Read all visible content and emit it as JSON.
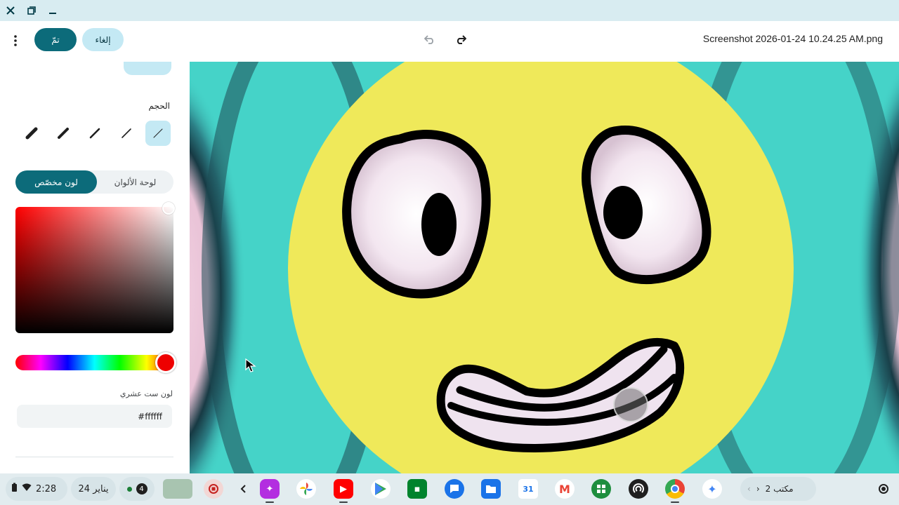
{
  "window": {
    "file_title": "Screenshot 2026-01-24 10.24.25 AM.png"
  },
  "header": {
    "done_label": "تمّ",
    "cancel_label": "إلغاء"
  },
  "panel": {
    "size_label": "الحجم",
    "size_options_count": 5,
    "color_mode": {
      "custom_label": "لون مخصّص",
      "palette_label": "لوحة الألوان",
      "selected": "custom"
    },
    "selected_hue_color": "#ee0000",
    "hex_label": "لون ست عشري",
    "hex_value": "#ffffff"
  },
  "shelf": {
    "time": "2:28",
    "date": "24 يناير",
    "notification_count": "4",
    "desk_label": "مكتب 2",
    "apps": [
      "screen-capture-icon",
      "photos-icon",
      "youtube-icon",
      "play-store-icon",
      "meet-icon",
      "chat-icon",
      "files-icon",
      "calendar-icon",
      "gmail-icon",
      "sheets-icon",
      "podcasts-icon",
      "chrome-icon",
      "gemini-icon"
    ]
  },
  "colors": {
    "accent": "#0c6b7a",
    "accent_light": "#c4e9f4",
    "face_yellow": "#efe95a",
    "background_teal": "#45d3c8"
  }
}
